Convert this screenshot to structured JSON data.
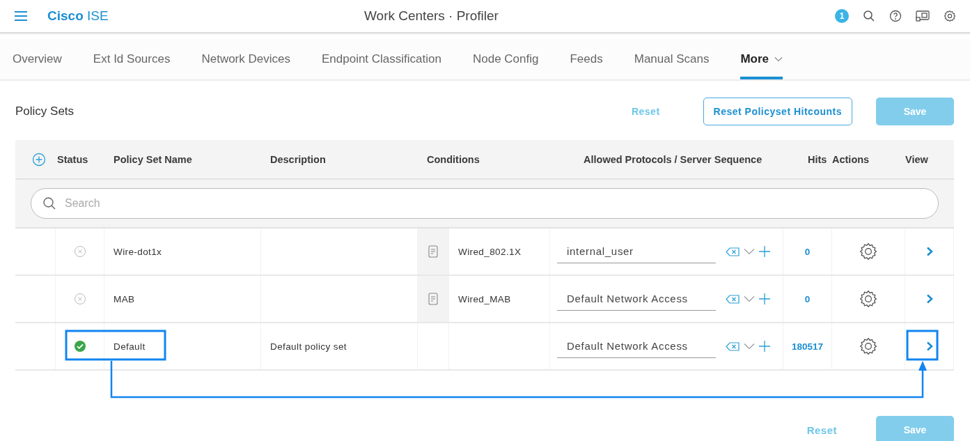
{
  "header": {
    "brand_bold": "Cisco",
    "brand_light": "ISE",
    "title": "Work Centers · Profiler",
    "notification_count": "1"
  },
  "tabs": [
    {
      "label": "Overview",
      "selected": false,
      "dropdown": false
    },
    {
      "label": "Ext Id Sources",
      "selected": false,
      "dropdown": false
    },
    {
      "label": "Network Devices",
      "selected": false,
      "dropdown": false
    },
    {
      "label": "Endpoint Classification",
      "selected": false,
      "dropdown": false
    },
    {
      "label": "Node Config",
      "selected": false,
      "dropdown": false
    },
    {
      "label": "Feeds",
      "selected": false,
      "dropdown": false
    },
    {
      "label": "Manual Scans",
      "selected": false,
      "dropdown": false
    },
    {
      "label": "More",
      "selected": true,
      "dropdown": true
    }
  ],
  "toolbar": {
    "title": "Policy Sets",
    "reset": "Reset",
    "reset_hitcounts": "Reset Policyset Hitcounts",
    "save": {
      "label": "Save",
      "disabled": true
    }
  },
  "table": {
    "columns": [
      "Status",
      "Policy Set Name",
      "Description",
      "Conditions",
      "Allowed Protocols / Server Sequence",
      "Hits",
      "Actions",
      "View"
    ],
    "search": {
      "placeholder": "Search"
    },
    "rows": [
      {
        "enabled": false,
        "name": "Wire-dot1x",
        "condition": "Wired_802.1X",
        "protocol": "internal_user",
        "hits": "0"
      },
      {
        "enabled": false,
        "name": "MAB",
        "condition": "Wired_MAB",
        "protocol": "Default Network Access",
        "hits": "0"
      },
      {
        "enabled": true,
        "name": "Default",
        "description": "Default policy set",
        "protocol": "Default Network Access",
        "hits": "180517"
      }
    ]
  },
  "footer": {
    "reset": "Reset",
    "save": {
      "label": "Save",
      "disabled": true
    }
  }
}
